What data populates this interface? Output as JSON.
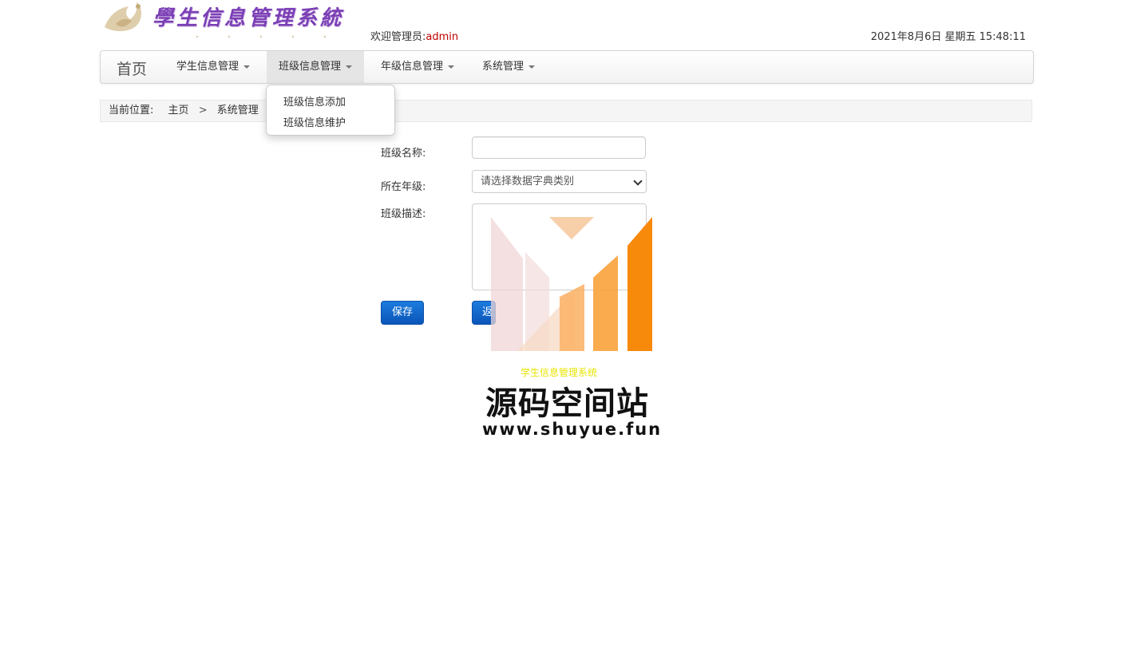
{
  "header": {
    "logo_text": "學生信息管理系統",
    "welcome_label": "欢迎管理员:",
    "user_name": "admin",
    "datetime": "2021年8月6日 星期五 15:48:11"
  },
  "nav": {
    "brand": "首页",
    "items": [
      {
        "label": "学生信息管理"
      },
      {
        "label": "班级信息管理",
        "active": true
      },
      {
        "label": "年级信息管理"
      },
      {
        "label": "系统管理"
      }
    ],
    "dropdown": [
      "班级信息添加",
      "班级信息维护"
    ]
  },
  "breadcrumb": {
    "prefix": "当前位置:",
    "items": [
      "主页",
      "系统管理"
    ],
    "separator": ">"
  },
  "form": {
    "class_name_label": "班级名称:",
    "class_name_value": "",
    "grade_label": "所在年级:",
    "grade_selected": "请选择数据字典类别",
    "description_label": "班级描述:",
    "description_value": "",
    "save_label": "保存",
    "back_label": "返"
  },
  "watermark": {
    "caption": "学生信息管理系统",
    "title": "源码空间站",
    "url": "www.shuyue.fun"
  },
  "colors": {
    "accent": "#0a55b8",
    "user": "#c00000",
    "logo": "#7b3fb5",
    "watermark_orange": "#f7890b"
  }
}
